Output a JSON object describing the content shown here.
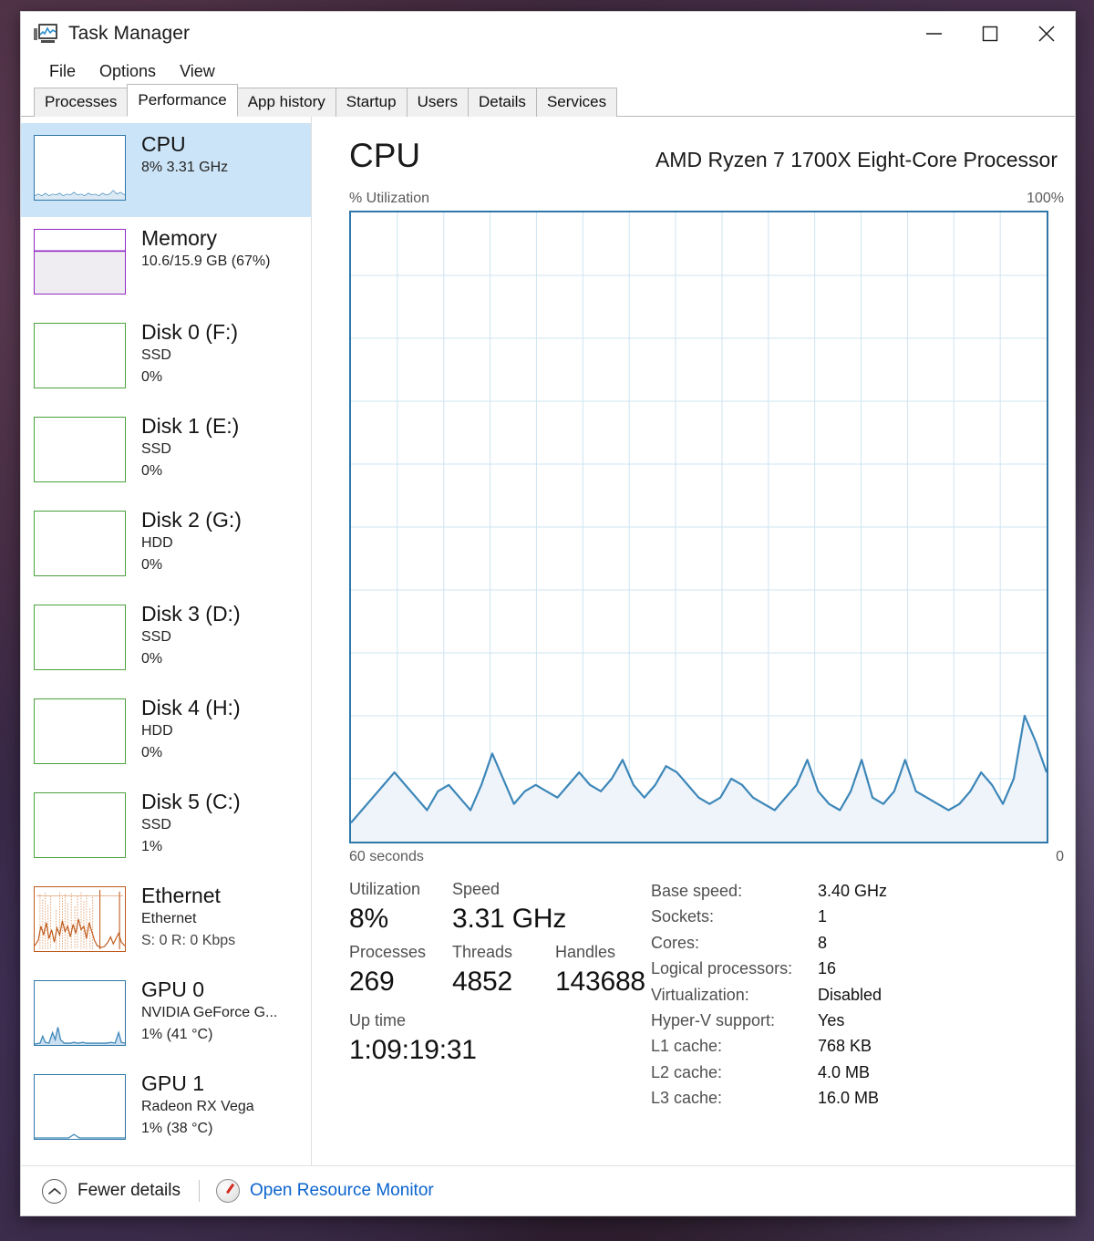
{
  "window": {
    "title": "Task Manager",
    "icon": "task-manager-icon",
    "controls": {
      "minimize": "minimize-icon",
      "maximize": "maximize-icon",
      "close": "close-icon"
    }
  },
  "menubar": {
    "items": [
      "File",
      "Options",
      "View"
    ]
  },
  "tabs": [
    {
      "label": "Processes",
      "active": false
    },
    {
      "label": "Performance",
      "active": true
    },
    {
      "label": "App history",
      "active": false
    },
    {
      "label": "Startup",
      "active": false
    },
    {
      "label": "Users",
      "active": false
    },
    {
      "label": "Details",
      "active": false
    },
    {
      "label": "Services",
      "active": false
    }
  ],
  "sidebar": {
    "items": [
      {
        "name": "cpu",
        "title": "CPU",
        "sub1": "8% 3.31 GHz",
        "sub2": "",
        "selected": true,
        "color": "#2e77a8",
        "graph": "cpu-thumb"
      },
      {
        "name": "memory",
        "title": "Memory",
        "sub1": "10.6/15.9 GB (67%)",
        "sub2": "",
        "selected": false,
        "color": "#9327c6",
        "graph": "memory-thumb"
      },
      {
        "name": "disk-0",
        "title": "Disk 0 (F:)",
        "sub1": "SSD",
        "sub2": "0%",
        "selected": false,
        "color": "#4aa23c",
        "graph": "flat-thumb"
      },
      {
        "name": "disk-1",
        "title": "Disk 1 (E:)",
        "sub1": "SSD",
        "sub2": "0%",
        "selected": false,
        "color": "#4aa23c",
        "graph": "flat-thumb"
      },
      {
        "name": "disk-2",
        "title": "Disk 2 (G:)",
        "sub1": "HDD",
        "sub2": "0%",
        "selected": false,
        "color": "#4aa23c",
        "graph": "flat-thumb"
      },
      {
        "name": "disk-3",
        "title": "Disk 3 (D:)",
        "sub1": "SSD",
        "sub2": "0%",
        "selected": false,
        "color": "#4aa23c",
        "graph": "flat-thumb"
      },
      {
        "name": "disk-4",
        "title": "Disk 4 (H:)",
        "sub1": "HDD",
        "sub2": "0%",
        "selected": false,
        "color": "#4aa23c",
        "graph": "flat-thumb"
      },
      {
        "name": "disk-5",
        "title": "Disk 5 (C:)",
        "sub1": "SSD",
        "sub2": "1%",
        "selected": false,
        "color": "#4aa23c",
        "graph": "flat-thumb"
      },
      {
        "name": "ethernet",
        "title": "Ethernet",
        "sub1": "Ethernet",
        "sub2": "S: 0 R: 0 Kbps",
        "selected": false,
        "color": "#bf5a1c",
        "graph": "ethernet-thumb"
      },
      {
        "name": "gpu-0",
        "title": "GPU 0",
        "sub1": "NVIDIA GeForce G...",
        "sub2": "1% (41 °C)",
        "selected": false,
        "color": "#2e77a8",
        "graph": "gpu0-thumb"
      },
      {
        "name": "gpu-1",
        "title": "GPU 1",
        "sub1": "Radeon RX Vega",
        "sub2": "1% (38 °C)",
        "selected": false,
        "color": "#2e77a8",
        "graph": "gpu1-thumb"
      }
    ]
  },
  "main": {
    "title": "CPU",
    "device": "AMD Ryzen 7 1700X Eight-Core Processor",
    "axis_y_label": "% Utilization",
    "axis_y_max": "100%",
    "axis_x_label": "60 seconds",
    "axis_x_end": "0",
    "stats": {
      "utilization": {
        "label": "Utilization",
        "value": "8%"
      },
      "speed": {
        "label": "Speed",
        "value": "3.31 GHz"
      },
      "processes": {
        "label": "Processes",
        "value": "269"
      },
      "threads": {
        "label": "Threads",
        "value": "4852"
      },
      "handles": {
        "label": "Handles",
        "value": "143688"
      },
      "uptime": {
        "label": "Up time",
        "value": "1:09:19:31"
      }
    },
    "specs": [
      {
        "key": "Base speed:",
        "value": "3.40 GHz"
      },
      {
        "key": "Sockets:",
        "value": "1"
      },
      {
        "key": "Cores:",
        "value": "8"
      },
      {
        "key": "Logical processors:",
        "value": "16"
      },
      {
        "key": "Virtualization:",
        "value": "Disabled"
      },
      {
        "key": "Hyper-V support:",
        "value": "Yes"
      },
      {
        "key": "L1 cache:",
        "value": "768 KB"
      },
      {
        "key": "L2 cache:",
        "value": "4.0 MB"
      },
      {
        "key": "L3 cache:",
        "value": "16.0 MB"
      }
    ]
  },
  "footer": {
    "fewer_details": "Fewer details",
    "fewer_details_icon": "chevron-up-circle-icon",
    "resource_monitor": "Open Resource Monitor",
    "resource_monitor_icon": "resource-monitor-icon"
  },
  "colors": {
    "cpu_line": "#3c86b8",
    "cpu_fill": "#eef4f9",
    "graph_border": "#2e77a8",
    "grid": "#cfe4f2",
    "selection": "#cce4f7",
    "link": "#0b63ce",
    "memory": "#9327c6",
    "disk": "#4aa23c",
    "ethernet": "#bf5a1c"
  },
  "chart_data": {
    "type": "area",
    "title": "CPU % Utilization",
    "xlabel": "60 seconds",
    "ylabel": "% Utilization",
    "ylim": [
      0,
      100
    ],
    "xlim": [
      60,
      0
    ],
    "grid": true,
    "legend": null,
    "series": [
      {
        "name": "CPU Utilization",
        "color": "#3c86b8",
        "values": [
          3,
          5,
          7,
          9,
          11,
          9,
          7,
          5,
          8,
          9,
          7,
          5,
          9,
          14,
          10,
          6,
          8,
          9,
          8,
          7,
          9,
          11,
          9,
          8,
          10,
          13,
          9,
          7,
          9,
          12,
          11,
          9,
          7,
          6,
          7,
          10,
          9,
          7,
          6,
          5,
          7,
          9,
          13,
          8,
          6,
          5,
          8,
          13,
          7,
          6,
          8,
          13,
          8,
          7,
          6,
          5,
          6,
          8,
          11,
          9,
          6,
          10,
          20,
          16,
          11
        ]
      }
    ]
  }
}
